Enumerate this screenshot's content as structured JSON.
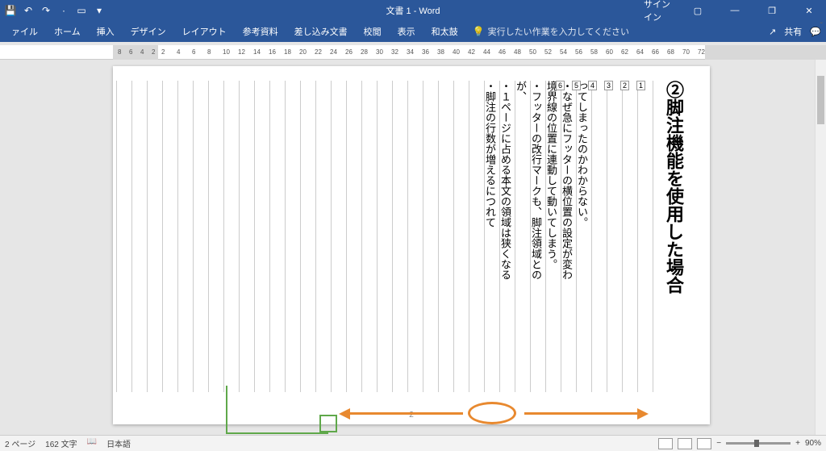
{
  "titlebar": {
    "title": "文書 1 - Word",
    "signin": "サインイン"
  },
  "ribbon": {
    "tabs": [
      "ァイル",
      "ホーム",
      "挿入",
      "デザイン",
      "レイアウト",
      "参考資料",
      "差し込み文書",
      "校閲",
      "表示",
      "和太鼓"
    ],
    "tellme_placeholder": "実行したい作業を入力してください",
    "share": "共有"
  },
  "ruler": {
    "left_nums": [
      "8",
      "6",
      "4",
      "2"
    ],
    "right_nums": [
      "2",
      "4",
      "6",
      "8",
      "10",
      "12",
      "14",
      "16",
      "18",
      "20",
      "22",
      "24",
      "26",
      "28",
      "30",
      "32",
      "34",
      "36",
      "38",
      "40",
      "42",
      "44",
      "46",
      "48",
      "50",
      "52",
      "54",
      "56",
      "58",
      "60",
      "62",
      "64",
      "66",
      "68",
      "70",
      "72"
    ]
  },
  "document": {
    "heading": "②脚注機能を使用した場合",
    "body_lines": [
      "・脚注の行数が増えるにつれて",
      "・１ページに占める本文の領域は狭くなる",
      "が、",
      "・フッターの改行マークも、脚注領域との",
      "境界線の位置に連動して動いてしまう。",
      "・なぜ急にフッターの横位置の設定が変わ",
      "ってしまったのかわからない。"
    ],
    "page_number": "2"
  },
  "statusbar": {
    "page": "2 ページ",
    "chars": "162 文字",
    "lang": "日本語",
    "zoom": "90%"
  }
}
